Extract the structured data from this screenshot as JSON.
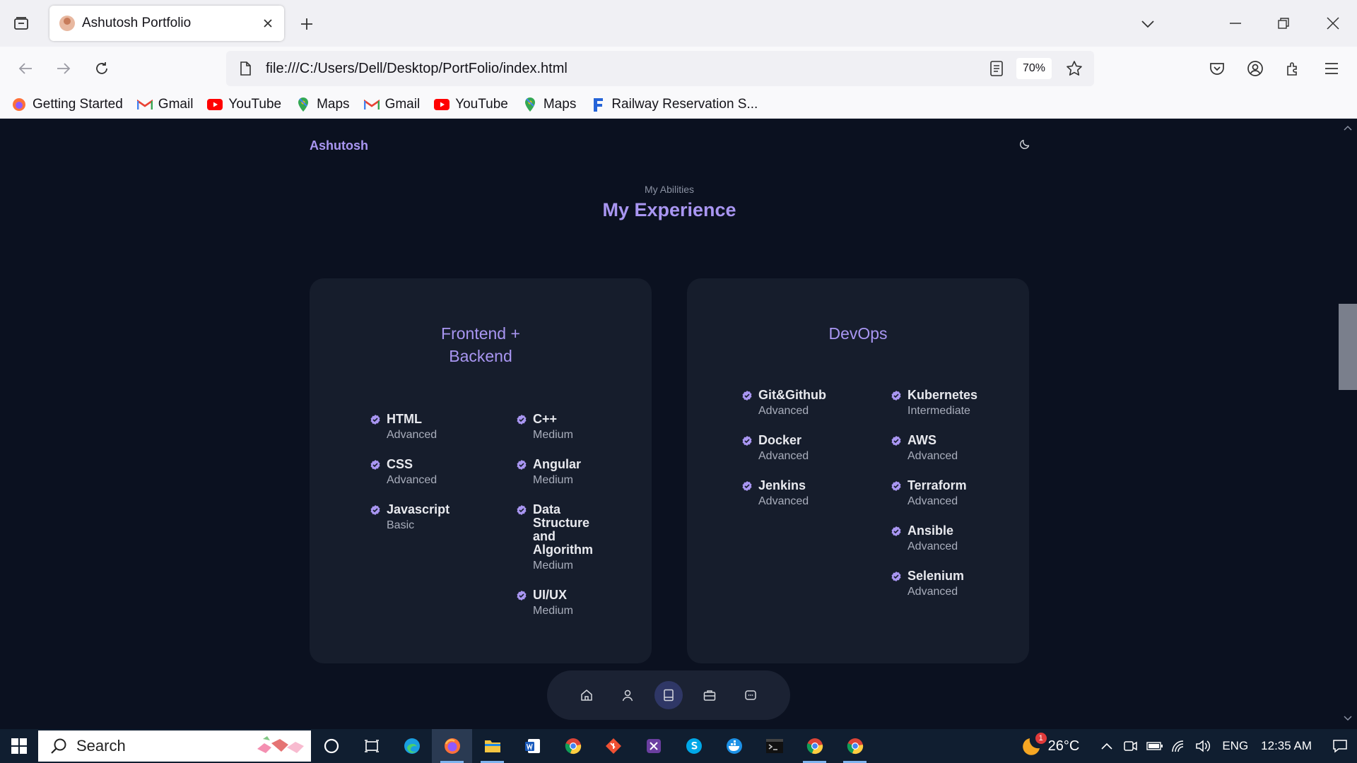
{
  "browser": {
    "tab": {
      "title": "Ashutosh Portfolio"
    },
    "url": "file:///C:/Users/Dell/Desktop/PortFolio/index.html",
    "zoom": "70%",
    "bookmarks": [
      {
        "label": "Getting Started",
        "icon": "firefox-icon"
      },
      {
        "label": "Gmail",
        "icon": "gmail-icon"
      },
      {
        "label": "YouTube",
        "icon": "youtube-icon"
      },
      {
        "label": "Maps",
        "icon": "maps-icon"
      },
      {
        "label": "Gmail",
        "icon": "gmail-icon"
      },
      {
        "label": "YouTube",
        "icon": "youtube-icon"
      },
      {
        "label": "Maps",
        "icon": "maps-icon"
      },
      {
        "label": "Railway Reservation S...",
        "icon": "railway-icon"
      }
    ]
  },
  "page": {
    "logo": "Ashutosh",
    "section_subtitle": "My Abilities",
    "section_title": "My Experience",
    "cards": [
      {
        "title_line1": "Frontend +",
        "title_line2": "Backend",
        "col1": [
          {
            "name": "HTML",
            "level": "Advanced"
          },
          {
            "name": "CSS",
            "level": "Advanced"
          },
          {
            "name": "Javascript",
            "level": "Basic"
          }
        ],
        "col2": [
          {
            "name": "C++",
            "level": "Medium"
          },
          {
            "name": "Angular",
            "level": "Medium"
          },
          {
            "name": "Data Structure and Algorithm",
            "level": "Medium"
          },
          {
            "name": "UI/UX",
            "level": "Medium"
          }
        ]
      },
      {
        "title_line1": "DevOps",
        "col1": [
          {
            "name": "Git&Github",
            "level": "Advanced"
          },
          {
            "name": "Docker",
            "level": "Advanced"
          },
          {
            "name": "Jenkins",
            "level": "Advanced"
          }
        ],
        "col2": [
          {
            "name": "Kubernetes",
            "level": "Intermediate"
          },
          {
            "name": "AWS",
            "level": "Advanced"
          },
          {
            "name": "Terraform",
            "level": "Advanced"
          },
          {
            "name": "Ansible",
            "level": "Advanced"
          },
          {
            "name": "Selenium",
            "level": "Advanced"
          }
        ]
      }
    ],
    "bottom_nav": [
      "home-icon",
      "user-icon",
      "document-icon",
      "briefcase-icon",
      "message-icon"
    ],
    "active_nav": "document-icon"
  },
  "taskbar": {
    "search_label": "Search",
    "weather_temp": "26°C",
    "weather_badge": "1",
    "language": "ENG",
    "time": "12:35 AM"
  },
  "colors": {
    "accent": "#a996f2",
    "page_bg": "#0b1120",
    "card_bg": "#161d2c"
  }
}
